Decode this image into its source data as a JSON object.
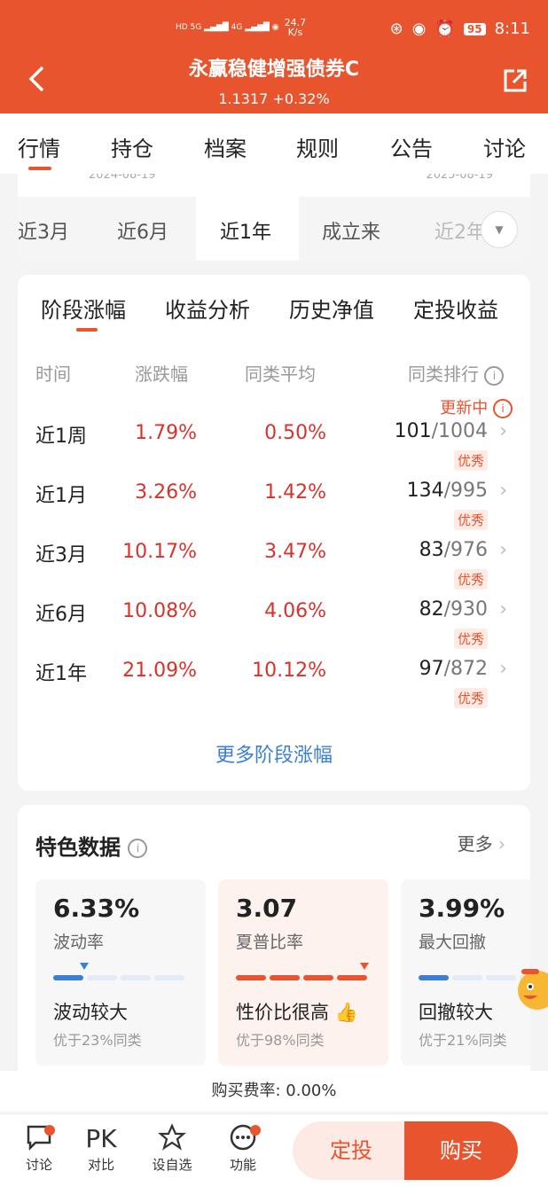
{
  "status_bar": {
    "net_speed": "24.7",
    "net_unit": "K/s",
    "battery": "95",
    "time": "8:11"
  },
  "header": {
    "title": "永赢稳健增强债券C",
    "nav_value": "1.1317 +0.32%"
  },
  "tabs": [
    "行情",
    "持仓",
    "档案",
    "规则",
    "公告",
    "讨论"
  ],
  "chart_dates": {
    "start": "2024-08-19",
    "end": "2025-08-19"
  },
  "periods": [
    "近3月",
    "近6月",
    "近1年",
    "成立来",
    "近2年"
  ],
  "perf": {
    "tabs": [
      "阶段涨幅",
      "收益分析",
      "历史净值",
      "定投收益"
    ],
    "headers": {
      "time": "时间",
      "change": "涨跌幅",
      "avg": "同类平均",
      "rank": "同类排行"
    },
    "updating": "更新中",
    "rows": [
      {
        "label": "近1周",
        "change": "1.79%",
        "avg": "0.50%",
        "rank": "101",
        "total": "/1004",
        "badge": "优秀"
      },
      {
        "label": "近1月",
        "change": "3.26%",
        "avg": "1.42%",
        "rank": "134",
        "total": "/995",
        "badge": "优秀"
      },
      {
        "label": "近3月",
        "change": "10.17%",
        "avg": "3.47%",
        "rank": "83",
        "total": "/976",
        "badge": "优秀"
      },
      {
        "label": "近6月",
        "change": "10.08%",
        "avg": "4.06%",
        "rank": "82",
        "total": "/930",
        "badge": "优秀"
      },
      {
        "label": "近1年",
        "change": "21.09%",
        "avg": "10.12%",
        "rank": "97",
        "total": "/872",
        "badge": "优秀"
      }
    ],
    "more": "更多阶段涨幅"
  },
  "features": {
    "title": "特色数据",
    "more": "更多",
    "metrics": [
      {
        "value": "6.33%",
        "name": "波动率",
        "desc": "波动较大",
        "sub": "优于23%同类",
        "level": 0.23
      },
      {
        "value": "3.07",
        "name": "夏普比率",
        "desc": "性价比很高",
        "sub": "优于98%同类",
        "level": 0.98
      },
      {
        "value": "3.99%",
        "name": "最大回撤",
        "desc": "回撤较大",
        "sub": "优于21%同类",
        "level": 0.21
      }
    ]
  },
  "fee": "购买费率: 0.00%",
  "bottom_nav": [
    {
      "label": "讨论",
      "icon": "chat-icon"
    },
    {
      "label": "对比",
      "icon": "PK"
    },
    {
      "label": "设自选",
      "icon": "star-icon"
    },
    {
      "label": "功能",
      "icon": "more-icon"
    }
  ],
  "actions": {
    "plan": "定投",
    "buy": "购买"
  },
  "colors": {
    "brand": "#e8542e",
    "up": "#d9322a",
    "link": "#3a7fd5",
    "bar_blue": "#3a7fd5"
  }
}
